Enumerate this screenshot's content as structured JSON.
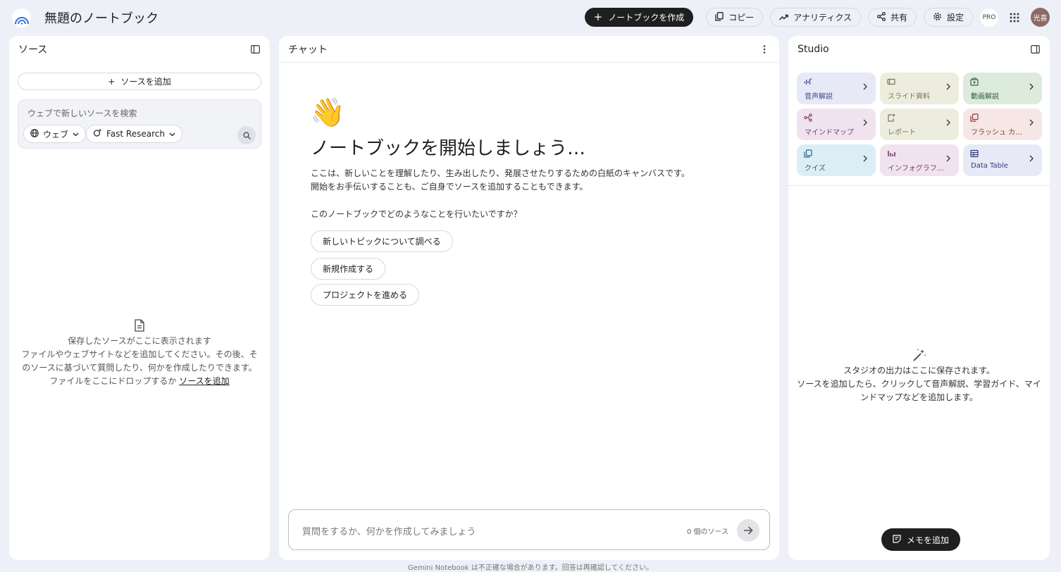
{
  "header": {
    "title": "無題のノートブック",
    "create_label": "ノートブックを作成",
    "copy_label": "コピー",
    "analytics_label": "アナリティクス",
    "share_label": "共有",
    "settings_label": "設定",
    "pro_label": "PRO",
    "avatar_text": "光喜"
  },
  "sources": {
    "title": "ソース",
    "add_label": "ソースを追加",
    "search_placeholder": "ウェブで新しいソースを検索",
    "web_chip": "ウェブ",
    "research_chip": "Fast Research",
    "empty_title": "保存したソースがここに表示されます",
    "empty_body": "ファイルやウェブサイトなどを追加してください。その後、そのソースに基づいて質問したり、何かを作成したりできます。",
    "empty_drop": "ファイルをここにドロップするか",
    "empty_link": "ソースを追加"
  },
  "chat": {
    "title": "チャット",
    "wave_emoji": "👋",
    "heading": "ノートブックを開始しましょう…",
    "description": "ここは、新しいことを理解したり、生み出したり、発展させたりするための白紙のキャンバスです。開始をお手伝いすることも、ご自身でソースを追加することもできます。",
    "question": "このノートブックでどのようなことを行いたいですか？",
    "suggestions": [
      "新しいトピックについて調べる",
      "新規作成する",
      "プロジェクトを進める"
    ],
    "input_placeholder": "質問をするか、何かを作成してみましょう",
    "source_count": "0 個のソース"
  },
  "studio": {
    "title": "Studio",
    "tiles": [
      {
        "label": "音声解説",
        "icon": "audio-icon",
        "bg": "#e7e9f7",
        "fg": "#3c4a8f"
      },
      {
        "label": "スライド資料",
        "icon": "slides-icon",
        "bg": "#ededdf",
        "fg": "#7a7350"
      },
      {
        "label": "動画解説",
        "icon": "video-icon",
        "bg": "#dcebdc",
        "fg": "#2f5f3a"
      },
      {
        "label": "マインドマップ",
        "icon": "mindmap-icon",
        "bg": "#f0e3ee",
        "fg": "#7a3b6e"
      },
      {
        "label": "レポート",
        "icon": "report-icon",
        "bg": "#ededdf",
        "fg": "#7a7350"
      },
      {
        "label": "フラッシュ カ…",
        "icon": "flashcard-icon",
        "bg": "#f6e6e6",
        "fg": "#8a3a3a"
      },
      {
        "label": "クイズ",
        "icon": "quiz-icon",
        "bg": "#dceef5",
        "fg": "#2b6580"
      },
      {
        "label": "インフォグラフ…",
        "icon": "infographic-icon",
        "bg": "#f0e3ee",
        "fg": "#7a3b6e"
      },
      {
        "label": "Data Table",
        "icon": "table-icon",
        "bg": "#e7e9f7",
        "fg": "#2e3e7a"
      }
    ],
    "empty_title": "スタジオの出力はここに保存されます。",
    "empty_body": "ソースを追加したら、クリックして音声解説、学習ガイド、マインドマップなどを追加します。",
    "memo_label": "メモを追加"
  },
  "footer": {
    "disclaimer": "Gemini Notebook は不正確な場合があります。回答は再確認してください。"
  }
}
